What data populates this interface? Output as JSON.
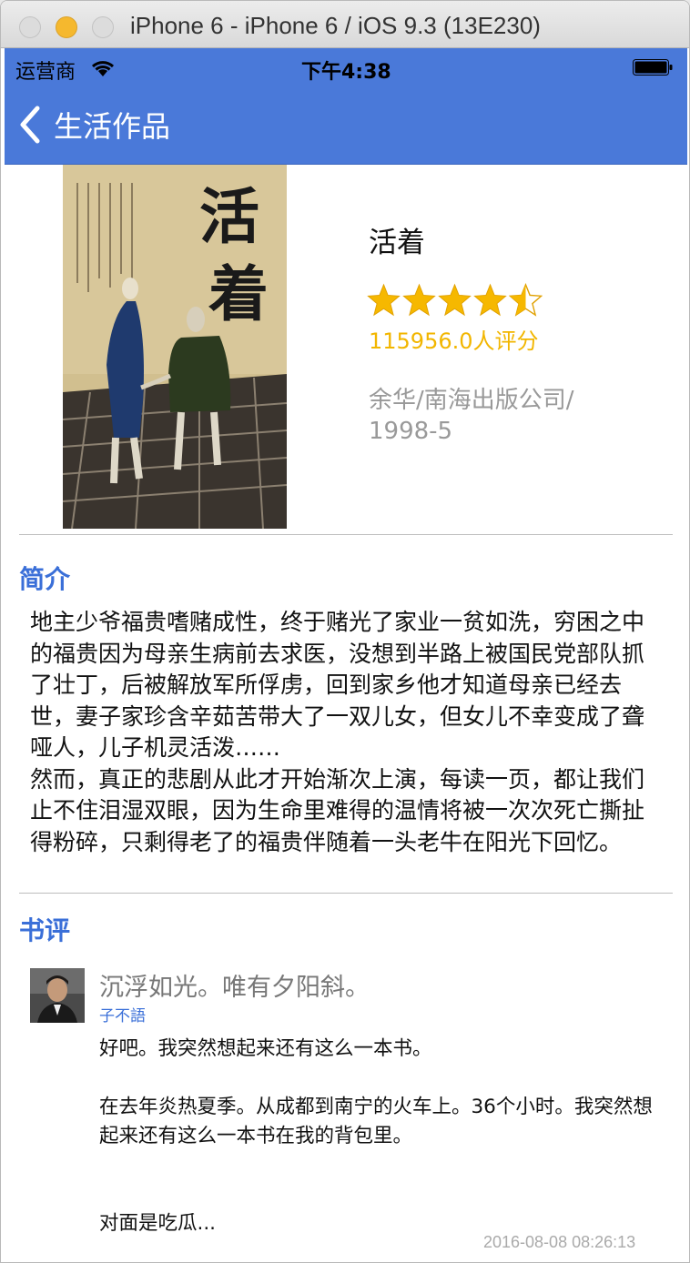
{
  "window": {
    "title": "iPhone 6 - iPhone 6 / iOS 9.3 (13E230)"
  },
  "status_bar": {
    "carrier": "运营商",
    "time": "下午4:38"
  },
  "nav": {
    "back_label": "生活作品"
  },
  "book": {
    "title": "活着",
    "rating_stars": 4.5,
    "rating_count": "115956.0人评分",
    "publisher": "余华/南海出版公司/\n1998-5",
    "cover_title": "活着"
  },
  "summary": {
    "heading": "简介",
    "text": "地主少爷福贵嗜赌成性，终于赌光了家业一贫如洗，穷困之中的福贵因为母亲生病前去求医，没想到半路上被国民党部队抓了壮丁，后被解放军所俘虏，回到家乡他才知道母亲已经去世，妻子家珍含辛茹苦带大了一双儿女，但女儿不幸变成了聋哑人，儿子机灵活泼……\n然而，真正的悲剧从此才开始渐次上演，每读一页，都让我们止不住泪湿双眼，因为生命里难得的温情将被一次次死亡撕扯得粉碎，只剩得老了的福贵伴随着一头老牛在阳光下回忆。"
  },
  "reviews": {
    "heading": "书评",
    "items": [
      {
        "title": "沉浮如光。唯有夕阳斜。",
        "author": "子不語",
        "body": "好吧。我突然想起来还有这么一本书。\n\n在去年炎热夏季。从成都到南宁的火车上。36个小时。我突然想起来还有这么一本书在我的背包里。\n\n\n对面是吃瓜...",
        "time": "2016-08-08 08:26:13"
      }
    ]
  },
  "colors": {
    "nav_blue": "#4a79d9",
    "accent_blue": "#3a6fd8",
    "rating_gold": "#f2b600",
    "muted_gray": "#999999"
  }
}
